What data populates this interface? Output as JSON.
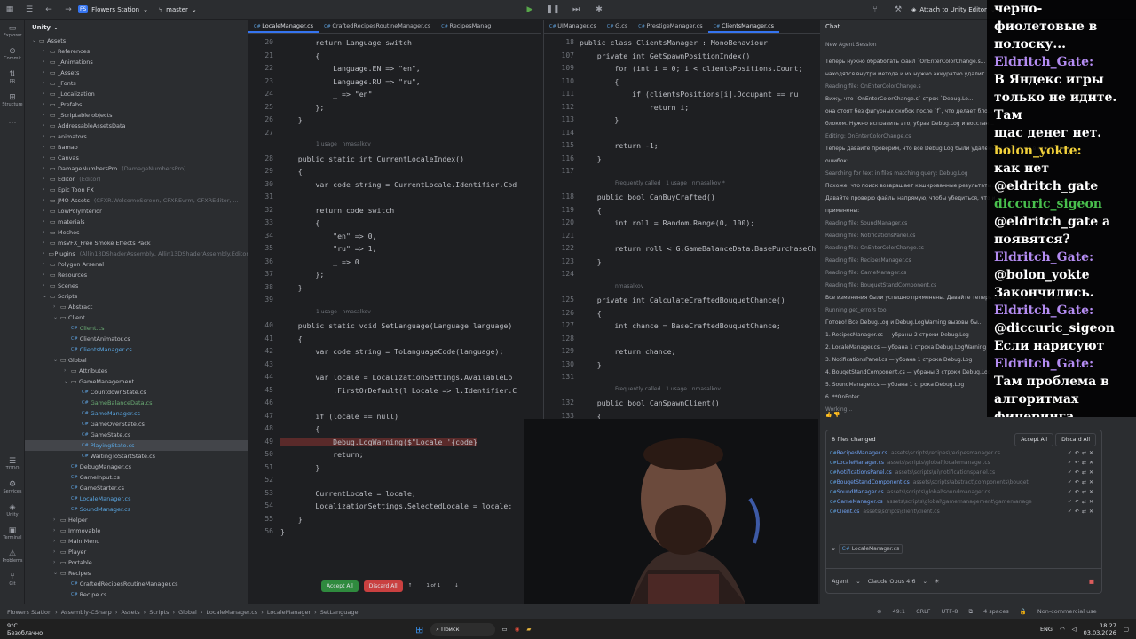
{
  "titlebar": {
    "project_badge": "FS",
    "project": "Flowers Station",
    "branch": "master",
    "attach": "Attach to Unity Editor"
  },
  "left_tools": [
    "Explorer",
    "Commit",
    "PR",
    "Structure",
    "TODO",
    "Services",
    "Unity",
    "Terminal",
    "Problems",
    "Git"
  ],
  "project_panel": {
    "title": "Unity",
    "rows": [
      {
        "d": 1,
        "t": "Assets",
        "a": "v",
        "k": "f"
      },
      {
        "d": 2,
        "t": "References",
        "a": ">",
        "k": "f"
      },
      {
        "d": 2,
        "t": "_Animations",
        "a": ">",
        "k": "f"
      },
      {
        "d": 2,
        "t": "_Assets",
        "a": ">",
        "k": "f"
      },
      {
        "d": 2,
        "t": "_Fonts",
        "a": ">",
        "k": "f"
      },
      {
        "d": 2,
        "t": "_Localization",
        "a": ">",
        "k": "f"
      },
      {
        "d": 2,
        "t": "_Prefabs",
        "a": ">",
        "k": "f"
      },
      {
        "d": 2,
        "t": "_Scriptable objects",
        "a": ">",
        "k": "f"
      },
      {
        "d": 2,
        "t": "AddressableAssetsData",
        "a": ">",
        "k": "f"
      },
      {
        "d": 2,
        "t": "animators",
        "a": ">",
        "k": "f"
      },
      {
        "d": 2,
        "t": "Bamao",
        "a": ">",
        "k": "f"
      },
      {
        "d": 2,
        "t": "Canvas",
        "a": ">",
        "k": "f"
      },
      {
        "d": 2,
        "t": "DamageNumbersPro",
        "a": ">",
        "k": "f",
        "h": "(DamageNumbersPro)"
      },
      {
        "d": 2,
        "t": "Editor",
        "a": ">",
        "k": "f",
        "h": "(Editor)"
      },
      {
        "d": 2,
        "t": "Epic Toon FX",
        "a": ">",
        "k": "f"
      },
      {
        "d": 2,
        "t": "JMO Assets",
        "a": ">",
        "k": "f",
        "h": "(CFXR.WelcomeScreen, CFXREvrm, CFXREditor, ..."
      },
      {
        "d": 2,
        "t": "LowPolyInterior",
        "a": ">",
        "k": "f"
      },
      {
        "d": 2,
        "t": "materials",
        "a": ">",
        "k": "f"
      },
      {
        "d": 2,
        "t": "Meshes",
        "a": ">",
        "k": "f"
      },
      {
        "d": 2,
        "t": "msVFX_Free Smoke Effects Pack",
        "a": ">",
        "k": "f"
      },
      {
        "d": 2,
        "t": "Plugins",
        "a": ">",
        "k": "f",
        "h": "(Allin13DShaderAssembly, Allin13DShaderAssembly.Editor"
      },
      {
        "d": 2,
        "t": "Polygon Arsenal",
        "a": ">",
        "k": "f"
      },
      {
        "d": 2,
        "t": "Resources",
        "a": ">",
        "k": "f"
      },
      {
        "d": 2,
        "t": "Scenes",
        "a": ">",
        "k": "f"
      },
      {
        "d": 2,
        "t": "Scripts",
        "a": "v",
        "k": "f"
      },
      {
        "d": 3,
        "t": "Abstract",
        "a": ">",
        "k": "f"
      },
      {
        "d": 3,
        "t": "Client",
        "a": "v",
        "k": "f"
      },
      {
        "d": 4,
        "t": "Client.cs",
        "k": "c",
        "c": "green"
      },
      {
        "d": 4,
        "t": "ClientAnimator.cs",
        "k": "c"
      },
      {
        "d": 4,
        "t": "ClientsManager.cs",
        "k": "c",
        "c": "blue"
      },
      {
        "d": 3,
        "t": "Global",
        "a": "v",
        "k": "f"
      },
      {
        "d": 4,
        "t": "Attributes",
        "a": ">",
        "k": "f"
      },
      {
        "d": 4,
        "t": "GameManagement",
        "a": "v",
        "k": "f"
      },
      {
        "d": 5,
        "t": "CountdownState.cs",
        "k": "c"
      },
      {
        "d": 5,
        "t": "GameBalanceData.cs",
        "k": "c",
        "c": "green"
      },
      {
        "d": 5,
        "t": "GameManager.cs",
        "k": "c",
        "c": "blue"
      },
      {
        "d": 5,
        "t": "GameOverState.cs",
        "k": "c"
      },
      {
        "d": 5,
        "t": "GameState.cs",
        "k": "c"
      },
      {
        "d": 5,
        "t": "PlayingState.cs",
        "k": "c",
        "c": "blue",
        "s": true
      },
      {
        "d": 5,
        "t": "WaitingToStartState.cs",
        "k": "c"
      },
      {
        "d": 4,
        "t": "DebugManager.cs",
        "k": "c"
      },
      {
        "d": 4,
        "t": "GameInput.cs",
        "k": "c"
      },
      {
        "d": 4,
        "t": "GameStarter.cs",
        "k": "c"
      },
      {
        "d": 4,
        "t": "LocaleManager.cs",
        "k": "c",
        "c": "blue"
      },
      {
        "d": 4,
        "t": "SoundManager.cs",
        "k": "c",
        "c": "blue"
      },
      {
        "d": 3,
        "t": "Helper",
        "a": ">",
        "k": "f"
      },
      {
        "d": 3,
        "t": "Immovable",
        "a": ">",
        "k": "f"
      },
      {
        "d": 3,
        "t": "Main Menu",
        "a": ">",
        "k": "f"
      },
      {
        "d": 3,
        "t": "Player",
        "a": ">",
        "k": "f"
      },
      {
        "d": 3,
        "t": "Portable",
        "a": ">",
        "k": "f"
      },
      {
        "d": 3,
        "t": "Recipes",
        "a": "v",
        "k": "f"
      },
      {
        "d": 4,
        "t": "CraftedRecipesRoutineManager.cs",
        "k": "c"
      },
      {
        "d": 4,
        "t": "Recipe.cs",
        "k": "c"
      }
    ]
  },
  "editor1": {
    "tabs": [
      "LocaleManager.cs",
      "CraftedRecipesRoutineManager.cs",
      "RecipesManag"
    ],
    "lines": [
      {
        "n": "20",
        "t": "        return Language switch"
      },
      {
        "n": "21",
        "t": "        {"
      },
      {
        "n": "22",
        "t": "            Language.EN => \"en\","
      },
      {
        "n": "23",
        "t": "            Language.RU => \"ru\","
      },
      {
        "n": "24",
        "t": "            _ => \"en\""
      },
      {
        "n": "25",
        "t": "        };"
      },
      {
        "n": "26",
        "t": "    }"
      },
      {
        "n": "27",
        "t": ""
      },
      {
        "n": "",
        "t": "1 usage   nmasalkov",
        "h": true
      },
      {
        "n": "28",
        "t": "    public static int CurrentLocaleIndex()"
      },
      {
        "n": "29",
        "t": "    {"
      },
      {
        "n": "30",
        "t": "        var code string = CurrentLocale.Identifier.Cod"
      },
      {
        "n": "31",
        "t": ""
      },
      {
        "n": "32",
        "t": "        return code switch"
      },
      {
        "n": "33",
        "t": "        {"
      },
      {
        "n": "34",
        "t": "            \"en\" => 0,"
      },
      {
        "n": "35",
        "t": "            \"ru\" => 1,"
      },
      {
        "n": "36",
        "t": "            _ => 0"
      },
      {
        "n": "37",
        "t": "        };"
      },
      {
        "n": "38",
        "t": "    }"
      },
      {
        "n": "39",
        "t": ""
      },
      {
        "n": "",
        "t": "1 usage   nmasalkov",
        "h": true
      },
      {
        "n": "40",
        "t": "    public static void SetLanguage(Language language)"
      },
      {
        "n": "41",
        "t": "    {"
      },
      {
        "n": "42",
        "t": "        var code string = ToLanguageCode(language);"
      },
      {
        "n": "43",
        "t": ""
      },
      {
        "n": "44",
        "t": "        var locale = LocalizationSettings.AvailableLo"
      },
      {
        "n": "45",
        "t": "            .FirstOrDefault(l Locale => l.Identifier.C"
      },
      {
        "n": "46",
        "t": ""
      },
      {
        "n": "47",
        "t": "        if (locale == null)"
      },
      {
        "n": "48",
        "t": "        {"
      },
      {
        "n": "49",
        "t": "            Debug.LogWarning($\"Locale '{code}",
        "e": true
      },
      {
        "n": "50",
        "t": "            return;"
      },
      {
        "n": "51",
        "t": "        }"
      },
      {
        "n": "52",
        "t": ""
      },
      {
        "n": "53",
        "t": "        CurrentLocale = locale;"
      },
      {
        "n": "54",
        "t": "        LocalizationSettings.SelectedLocale = locale;"
      },
      {
        "n": "55",
        "t": "    }"
      },
      {
        "n": "56",
        "t": "}"
      }
    ],
    "accept_all": "Accept All",
    "discard_all": "Discard All",
    "pager": "1 of 1"
  },
  "editor2": {
    "tabs": [
      "UIManager.cs",
      "G.cs",
      "PrestigeManager.cs",
      "ClientsManager.cs"
    ],
    "lines": [
      {
        "n": "18",
        "t": "public class ClientsManager : MonoBehaviour"
      },
      {
        "n": "107",
        "t": "    private int GetSpawnPositionIndex()"
      },
      {
        "n": "109",
        "t": "        for (int i = 0; i < clientsPositions.Count; "
      },
      {
        "n": "110",
        "t": "        {"
      },
      {
        "n": "111",
        "t": "            if (clientsPositions[i].Occupant == nu"
      },
      {
        "n": "112",
        "t": "                return i;"
      },
      {
        "n": "113",
        "t": "        }"
      },
      {
        "n": "114",
        "t": ""
      },
      {
        "n": "115",
        "t": "        return -1;"
      },
      {
        "n": "116",
        "t": "    }"
      },
      {
        "n": "117",
        "t": ""
      },
      {
        "n": "",
        "t": "Frequently called   1 usage   nmasalkov *",
        "h": true
      },
      {
        "n": "118",
        "t": "    public bool CanBuyCrafted()"
      },
      {
        "n": "119",
        "t": "    {"
      },
      {
        "n": "120",
        "t": "        int roll = Random.Range(0, 100);"
      },
      {
        "n": "121",
        "t": ""
      },
      {
        "n": "122",
        "t": "        return roll < G.GameBalanceData.BasePurchaseCh"
      },
      {
        "n": "123",
        "t": "    }"
      },
      {
        "n": "124",
        "t": ""
      },
      {
        "n": "",
        "t": "nmasalkov",
        "h": true
      },
      {
        "n": "125",
        "t": "    private int CalculateCraftedBouquetChance()"
      },
      {
        "n": "126",
        "t": "    {"
      },
      {
        "n": "127",
        "t": "        int chance = BaseCraftedBouquetChance;"
      },
      {
        "n": "128",
        "t": ""
      },
      {
        "n": "129",
        "t": "        return chance;"
      },
      {
        "n": "130",
        "t": "    }"
      },
      {
        "n": "131",
        "t": ""
      },
      {
        "n": "",
        "t": "Frequently called   1 usage   nmasalkov",
        "h": true
      },
      {
        "n": "132",
        "t": "    public bool CanSpawnClient()"
      },
      {
        "n": "133",
        "t": "    {"
      },
      {
        "n": "134",
        "t": "        foreach (var "
      },
      {
        "n": "135",
        "t": "        {"
      },
      {
        "n": "136",
        "t": "            if (pos"
      },
      {
        "n": "137",
        "t": "                re"
      },
      {
        "n": "138",
        "t": "        }"
      },
      {
        "n": "139",
        "t": "        return f"
      },
      {
        "n": "140",
        "t": "    }"
      },
      {
        "n": "142",
        "t": ""
      }
    ]
  },
  "chat": {
    "title": "Chat",
    "session": "New Agent Session",
    "lines": [
      {
        "t": "Теперь нужно обработать файл `OnEnterColorChange.s...",
        "s": false
      },
      {
        "t": "находятся внутри метода и их нужно аккуратно удалит...",
        "s": false
      },
      {
        "t": "Reading file: OnEnterColorChange.s",
        "s": true
      },
      {
        "t": "Вижу, что `OnEnterColorChange.s` строк `Debug.Lo...",
        "s": false
      },
      {
        "t": "она стоят без фигурных скобок после `f`, что делает бло...",
        "s": false
      },
      {
        "t": "блоком. Нужно исправить это, убрав Debug.Log и восстан...",
        "s": false
      },
      {
        "t": "Editing: OnEnterColorChange.cs",
        "s": true
      },
      {
        "t": "Теперь давайте проверим, что все Debug.Log были удалены, и убедимся в отсутствии",
        "s": false
      },
      {
        "t": "ошибок:",
        "s": false
      },
      {
        "t": "Searching for text in files matching query: Debug.Log",
        "s": true
      },
      {
        "t": "Похоже, что поиск возвращает кэшированные результаты...",
        "s": false
      },
      {
        "t": "Давайте проверю файлы напрямую, чтобы убедиться, что и...",
        "s": false
      },
      {
        "t": "применены:",
        "s": false
      },
      {
        "t": "Reading file: SoundManager.cs",
        "s": true
      },
      {
        "t": "Reading file: NotificationsPanel.cs",
        "s": true
      },
      {
        "t": "Reading file: OnEnterColorChange.cs",
        "s": true
      },
      {
        "t": "Reading file: RecipesManager.cs",
        "s": true
      },
      {
        "t": "Reading file: GameManager.cs",
        "s": true
      },
      {
        "t": "Reading file: BouquetStandComponent.cs",
        "s": true
      },
      {
        "t": "Все изменения были успешно применены. Давайте теперь проверим файлы на ошибки:",
        "s": false
      },
      {
        "t": "Running get_errors tool",
        "s": true
      },
      {
        "t": "Готово! Все Debug.Log и Debug.LogWarning вызовы бы...",
        "s": false
      },
      {
        "t": "1. RecipesManager.cs — убраны 2 строки Debug.Log",
        "s": false
      },
      {
        "t": "2. LocaleManager.cs — убрана 1 строка Debug.LogWarning",
        "s": false
      },
      {
        "t": "3. NotificationsPanel.cs — убрана 1 строка Debug.Log",
        "s": false
      },
      {
        "t": "4. BouqetStandComponent.cs — убраны 3 строки Debug.Log",
        "s": false
      },
      {
        "t": "5. SoundManager.cs — убрана 1 строка Debug.Log",
        "s": false
      },
      {
        "t": "6. **OnEnter",
        "s": false
      },
      {
        "t": "Working...",
        "s": true
      }
    ],
    "files_changed": "8 files changed",
    "accept_all": "Accept All",
    "discard_all": "Discard All",
    "files": [
      {
        "n": "RecipesManager.cs",
        "p": "assets\\scripts\\recipes\\recipesmanager.cs"
      },
      {
        "n": "LocaleManager.cs",
        "p": "assets\\scripts\\global\\localemanager.cs"
      },
      {
        "n": "NotificationsPanel.cs",
        "p": "assets\\scripts\\ui\\notificationspanel.cs"
      },
      {
        "n": "BouqetStandComponent.cs",
        "p": "assets\\scripts\\abstract\\components\\bouqet"
      },
      {
        "n": "SoundManager.cs",
        "p": "assets\\scripts\\global\\soundmanager.cs"
      },
      {
        "n": "GameManager.cs",
        "p": "assets\\scripts\\global\\gamemanagement\\gamemanage"
      },
      {
        "n": "Client.cs",
        "p": "assets\\scripts\\client\\client.cs"
      }
    ],
    "attached_file": "LocaleManager.cs",
    "agent": "Agent",
    "model": "Claude Opus 4.6"
  },
  "statusbar": {
    "crumbs": [
      "Flowers Station",
      "Assembly-CSharp",
      "Assets",
      "Scripts",
      "Global",
      "LocaleManager.cs",
      "LocaleManager",
      "SetLanguage"
    ],
    "pos": "49:1",
    "crlf": "CRLF",
    "enc": "UTF-8",
    "indent": "4 spaces",
    "license": "Non-commercial use"
  },
  "taskbar": {
    "temp": "9°C",
    "weather": "Безоблачно",
    "search": "Поиск",
    "lang": "ENG",
    "time": "18:27",
    "date": "03.03.2026"
  },
  "stream_chat": [
    {
      "t": "черно-фиолетовые в",
      "c": ""
    },
    {
      "t": "полоску...",
      "c": ""
    },
    {
      "t": "Eldritch_Gate:",
      "c": "u"
    },
    {
      "t": "В Яндекс игры",
      "c": ""
    },
    {
      "t": "только не идите. Там",
      "c": ""
    },
    {
      "t": "щас денег нет.",
      "c": ""
    },
    {
      "t": "bolon_yokte:",
      "c": "y"
    },
    {
      "t": "как нет",
      "c": ""
    },
    {
      "t": "@eldritch_gate",
      "c": ""
    },
    {
      "t": "diccuric_sigeon",
      "c": "g"
    },
    {
      "t": "@eldritch_gate а",
      "c": ""
    },
    {
      "t": "появятся?",
      "c": ""
    },
    {
      "t": "Eldritch_Gate:",
      "c": "u"
    },
    {
      "t": "@bolon_yokte",
      "c": ""
    },
    {
      "t": "Закончились.",
      "c": ""
    },
    {
      "t": "Eldritch_Gate:",
      "c": "u"
    },
    {
      "t": "@diccuric_sigeon",
      "c": ""
    },
    {
      "t": "Если нарисуют",
      "c": ""
    },
    {
      "t": "Eldritch_Gate:",
      "c": "u"
    },
    {
      "t": "Там проблема в",
      "c": ""
    },
    {
      "t": "алгоритмах",
      "c": ""
    },
    {
      "t": "фичеринга.",
      "c": ""
    }
  ],
  "colors": {
    "accent": "#3574f0",
    "error": "#db5c5c",
    "green": "#6aab73"
  }
}
